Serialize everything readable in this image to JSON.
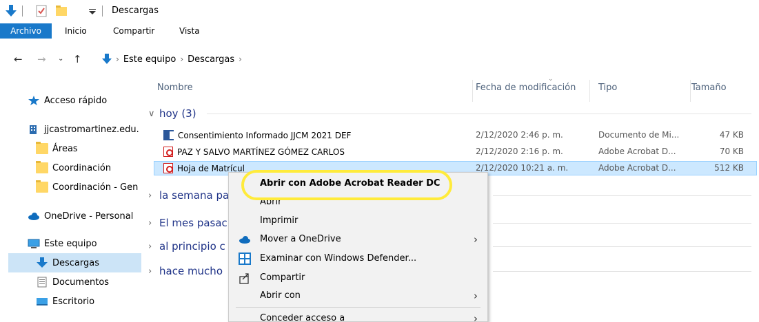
{
  "window": {
    "title": "Descargas"
  },
  "ribbon": {
    "tabs": [
      {
        "label": "Archivo"
      },
      {
        "label": "Inicio"
      },
      {
        "label": "Compartir"
      },
      {
        "label": "Vista"
      }
    ]
  },
  "address": {
    "crumbs": [
      "Este equipo",
      "Descargas"
    ]
  },
  "nav": {
    "items": [
      {
        "label": "Acceso rápido",
        "icon": "star-icon"
      },
      {
        "label": "jjcastromartinez.edu.",
        "icon": "building-icon"
      },
      {
        "label": "Áreas",
        "icon": "folder-icon"
      },
      {
        "label": "Coordinación",
        "icon": "folder-icon"
      },
      {
        "label": "Coordinación - Gen",
        "icon": "folder-icon"
      },
      {
        "label": "OneDrive - Personal",
        "icon": "cloud-icon"
      },
      {
        "label": "Este equipo",
        "icon": "computer-icon"
      },
      {
        "label": "Descargas",
        "icon": "download-icon"
      },
      {
        "label": "Documentos",
        "icon": "document-icon"
      },
      {
        "label": "Escritorio",
        "icon": "desktop-icon"
      }
    ]
  },
  "columns": {
    "name": "Nombre",
    "date": "Fecha de modificación",
    "type": "Tipo",
    "size": "Tamaño"
  },
  "groups": [
    {
      "label": "hoy (3)"
    },
    {
      "label": "la semana pa"
    },
    {
      "label": "El mes pasac"
    },
    {
      "label": "al principio c"
    },
    {
      "label": "hace mucho"
    }
  ],
  "files": [
    {
      "name": "Consentimiento Informado JJCM 2021 DEF",
      "date": "2/12/2020 2:46 p. m.",
      "type": "Documento de Mi...",
      "size": "47 KB",
      "icon": "word-icon"
    },
    {
      "name": "PAZ Y SALVO MARTÍNEZ GÓMEZ CARLOS",
      "date": "2/12/2020 2:16 p. m.",
      "type": "Adobe Acrobat D...",
      "size": "70 KB",
      "icon": "pdf-icon"
    },
    {
      "name": "Hoja de Matrícul",
      "date": "2/12/2020 10:21 a. m.",
      "type": "Adobe Acrobat D...",
      "size": "512 KB",
      "icon": "pdf-icon"
    }
  ],
  "context_menu": {
    "items": [
      {
        "label": "Abrir con Adobe Acrobat Reader DC"
      },
      {
        "label": "Abrir"
      },
      {
        "label": "Imprimir"
      },
      {
        "label": "Mover a OneDrive"
      },
      {
        "label": "Examinar con Windows Defender..."
      },
      {
        "label": "Compartir"
      },
      {
        "label": "Abrir con"
      },
      {
        "label": "Conceder acceso a"
      }
    ]
  },
  "colors": {
    "accent": "#1979ca",
    "selection": "#cce8ff",
    "highlight": "#ffeb3b",
    "group_text": "#1e3287"
  }
}
